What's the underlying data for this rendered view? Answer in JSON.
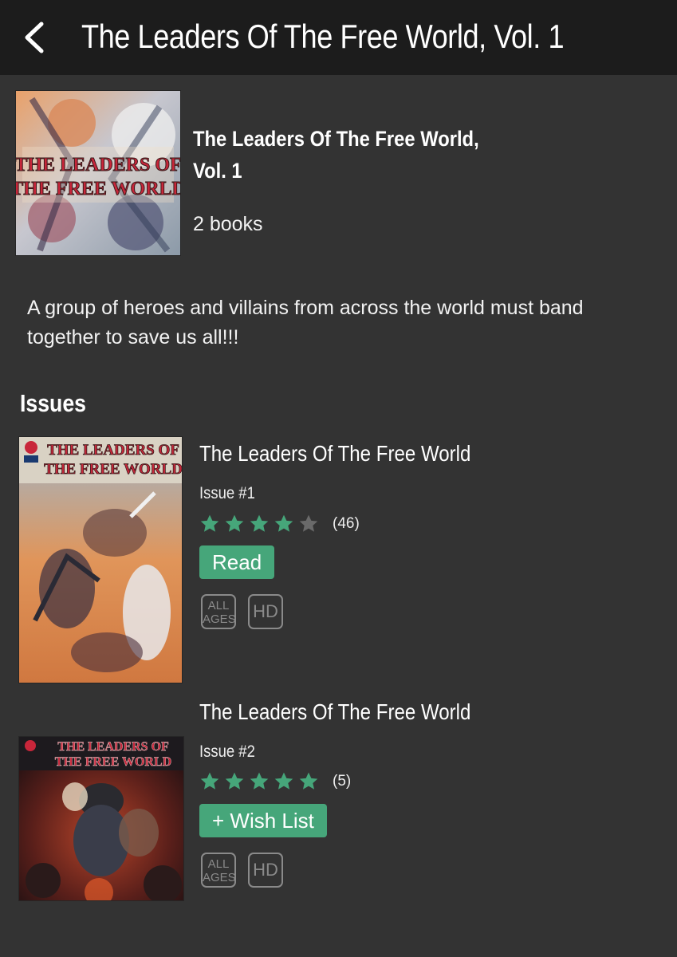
{
  "header": {
    "title": "The Leaders Of The Free World, Vol. 1"
  },
  "series": {
    "title": "The Leaders Of The Free World, Vol. 1",
    "book_count": "2 books",
    "description": "A group of heroes and villains from across the world must band together to save us all!!!",
    "cover_text": "THE LEADERS OF THE FREE WORLD"
  },
  "issues_heading": "Issues",
  "issues": [
    {
      "title": "The Leaders Of The Free World",
      "number": "Issue #1",
      "rating_stars": 4,
      "rating_count": "(46)",
      "action_label": "Read",
      "badge_age": [
        "ALL",
        "AGES"
      ],
      "badge_hd": "HD",
      "cover_text": "THE LEADERS OF THE FREE WORLD"
    },
    {
      "title": "The Leaders Of The Free World",
      "number": "Issue #2",
      "rating_stars": 5,
      "rating_count": "(5)",
      "action_label": "+ Wish List",
      "badge_age": [
        "ALL",
        "AGES"
      ],
      "badge_hd": "HD",
      "cover_text": "THE LEADERS OF THE FREE WORLD"
    }
  ],
  "colors": {
    "background": "#333333",
    "topbar": "#1c1c1c",
    "accent": "#46a67a",
    "star_filled": "#46a67a",
    "star_empty": "#6a6a6a",
    "badge": "#8a8a8a"
  }
}
